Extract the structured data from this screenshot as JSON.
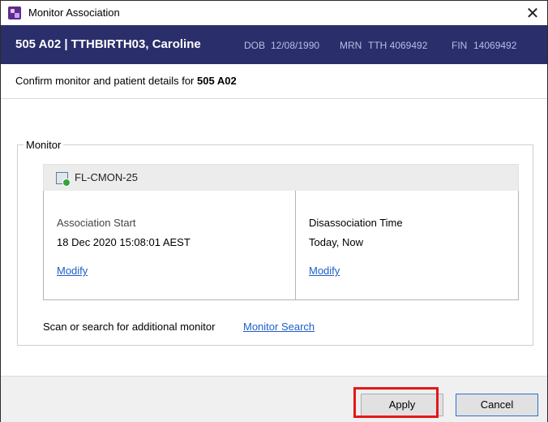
{
  "window": {
    "title": "Monitor Association",
    "close_glyph": "✕"
  },
  "banner": {
    "room_patient": "505 A02 | TTHBIRTH03, Caroline",
    "dob_label": "DOB",
    "dob_value": "12/08/1990",
    "mrn_label": "MRN",
    "mrn_value": "TTH 4069492",
    "fin_label": "FIN",
    "fin_value": "14069492"
  },
  "confirm": {
    "prefix": "Confirm monitor and patient details for",
    "location": "505 A02"
  },
  "monitor_group": {
    "legend": "Monitor",
    "device_name": "FL-CMON-25",
    "association_start_label": "Association Start",
    "association_start_value": "18 Dec 2020 15:08:01 AEST",
    "association_modify": "Modify",
    "disassociation_label": "Disassociation Time",
    "disassociation_value": "Today, Now",
    "disassociation_modify": "Modify",
    "scan_text": "Scan or search for additional monitor",
    "search_link": "Monitor Search"
  },
  "footer": {
    "apply_label": "Apply",
    "cancel_label": "Cancel"
  },
  "colors": {
    "banner": "#2a2e6b",
    "link": "#1f5fc7",
    "highlight": "#e11919"
  }
}
